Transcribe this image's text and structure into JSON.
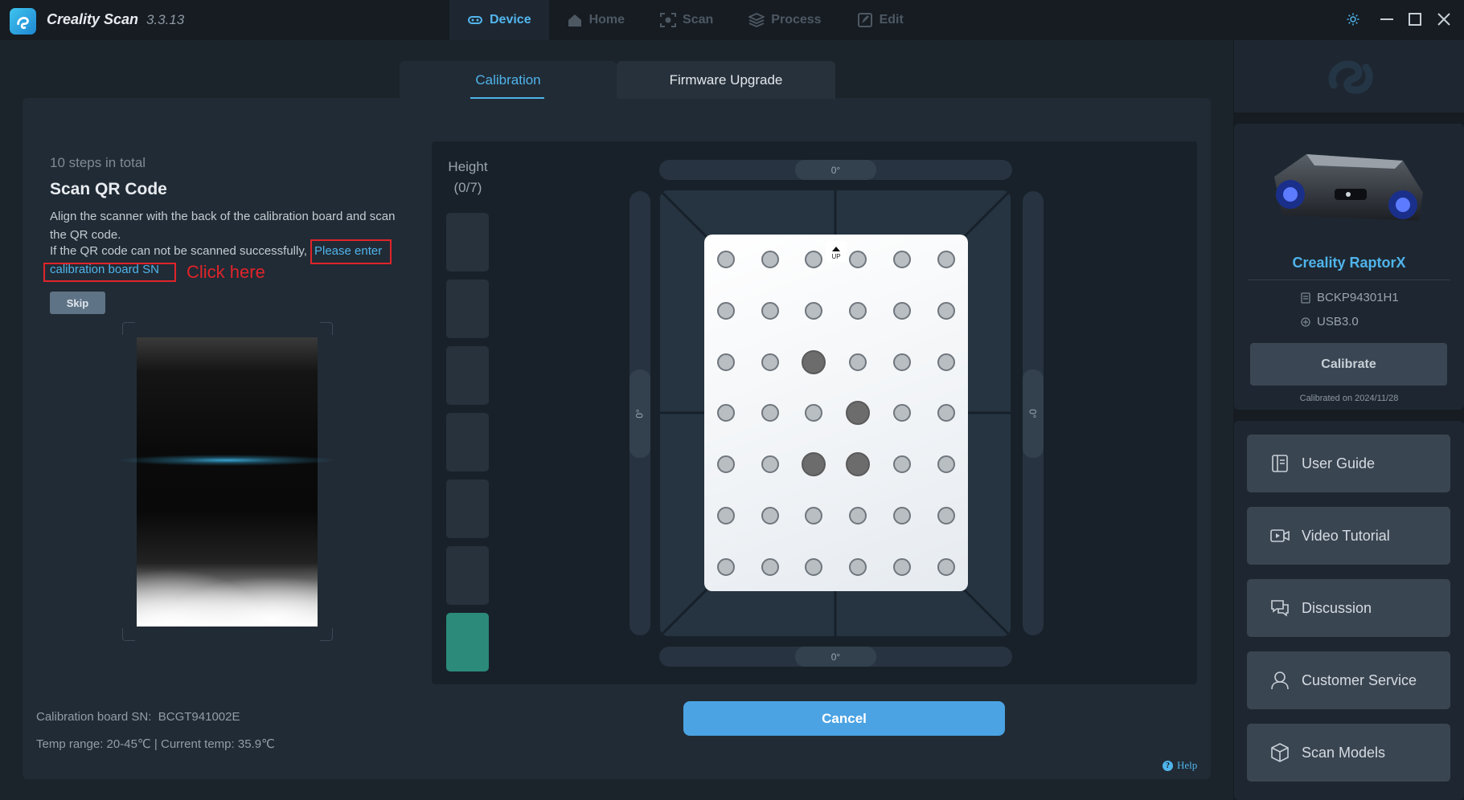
{
  "app": {
    "name": "Creality Scan",
    "version": "3.3.13"
  },
  "nav": [
    {
      "label": "Device",
      "icon": "device-icon",
      "active": true
    },
    {
      "label": "Home",
      "icon": "home-icon",
      "active": false
    },
    {
      "label": "Scan",
      "icon": "scan-icon",
      "active": false
    },
    {
      "label": "Process",
      "icon": "layers-icon",
      "active": false
    },
    {
      "label": "Edit",
      "icon": "edit-icon",
      "active": false
    }
  ],
  "tabs": {
    "calibration": "Calibration",
    "firmware": "Firmware Upgrade"
  },
  "step": {
    "total": "10 steps in total",
    "title": "Scan QR Code",
    "desc": "Align the scanner with the back of the calibration board and scan the QR code.",
    "fail_text": "If the QR code can not be scanned successfully,",
    "link_part1": "Please enter",
    "link_part2": "calibration board SN",
    "annotation": "Click here",
    "skip_label": "Skip"
  },
  "info": {
    "sn_label": "Calibration board SN:",
    "sn_value": "BCGT941002E",
    "temp_text": "Temp range: 20-45℃  |  Current temp: 35.9℃"
  },
  "height": {
    "label": "Height",
    "progress": "(0/7)",
    "current_level": 1,
    "levels": 7
  },
  "angles": {
    "top": "0°",
    "bottom": "0°",
    "left": "0°",
    "right": "0°"
  },
  "board": {
    "up_label": "UP",
    "rows": 7,
    "cols": 6,
    "highlighted": [
      [
        2,
        2
      ],
      [
        3,
        3
      ],
      [
        4,
        2
      ],
      [
        4,
        3
      ]
    ]
  },
  "cancel_label": "Cancel",
  "help_label": "Help",
  "device": {
    "name": "Creality RaptorX",
    "serial": "BCKP94301H1",
    "connection": "USB3.0",
    "calibrate_label": "Calibrate",
    "calibrated_on": "Calibrated on 2024/11/28"
  },
  "side_links": [
    {
      "label": "User Guide",
      "icon": "book-icon"
    },
    {
      "label": "Video Tutorial",
      "icon": "video-icon"
    },
    {
      "label": "Discussion",
      "icon": "chat-icon"
    },
    {
      "label": "Customer Service",
      "icon": "headset-icon"
    },
    {
      "label": "Scan Models",
      "icon": "cube-icon"
    }
  ],
  "colors": {
    "accent": "#4fb4eb",
    "annotation_red": "#e0242a",
    "height_active": "#2c8a7a"
  }
}
